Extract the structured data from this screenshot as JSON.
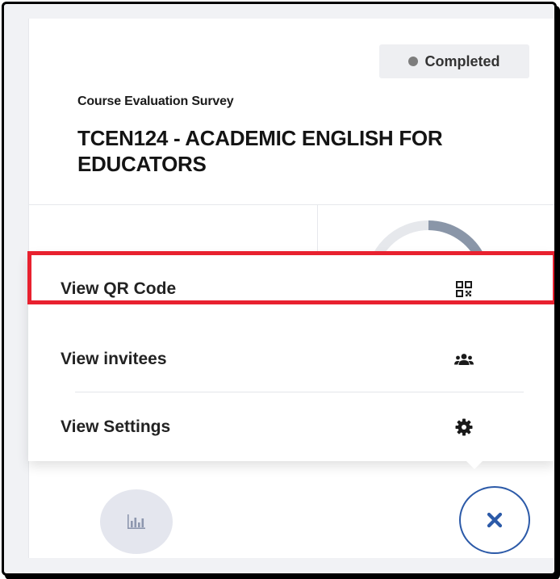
{
  "status": {
    "label": "Completed",
    "dot_color": "#7d7d7d"
  },
  "survey": {
    "type": "Course Evaluation Survey",
    "title": "TCEN124 - ACADEMIC ENGLISH FOR EDUCATORS"
  },
  "menu": {
    "items": [
      {
        "label": "View QR Code",
        "icon": "qr-code-icon"
      },
      {
        "label": "View invitees",
        "icon": "users-icon"
      },
      {
        "label": "View Settings",
        "icon": "gear-icon"
      }
    ]
  },
  "actions": {
    "chart_icon": "bar-chart-icon",
    "close_icon": "close-icon"
  },
  "colors": {
    "highlight": "#e8212f",
    "accent": "#2c5aa8",
    "ring_progress": "#8a96a8",
    "ring_track": "#e6e8ec"
  }
}
